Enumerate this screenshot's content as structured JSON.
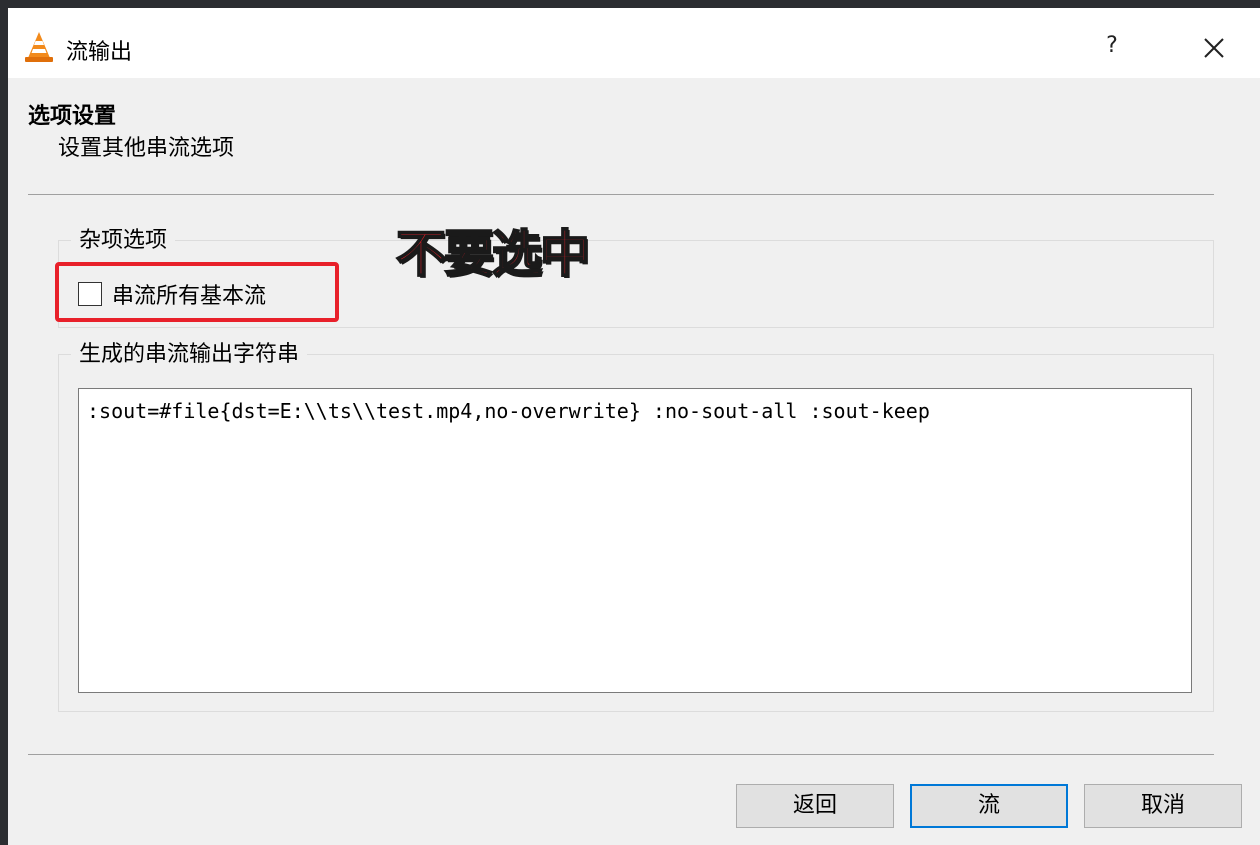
{
  "window": {
    "title": "流输出",
    "help_label": "?"
  },
  "header": {
    "title": "选项设置",
    "subtitle": "设置其他串流选项"
  },
  "misc_options": {
    "legend": "杂项选项",
    "checkbox_label": "串流所有基本流",
    "checked": false
  },
  "annotation": {
    "text": "不要选中",
    "color": "#e8202a"
  },
  "output_string": {
    "legend": "生成的串流输出字符串",
    "value": ":sout=#file{dst=E:\\\\ts\\\\test.mp4,no-overwrite} :no-sout-all :sout-keep"
  },
  "buttons": {
    "back": "返回",
    "stream": "流",
    "cancel": "取消"
  },
  "colors": {
    "accent": "#0078d7",
    "highlight": "#e8202a"
  }
}
